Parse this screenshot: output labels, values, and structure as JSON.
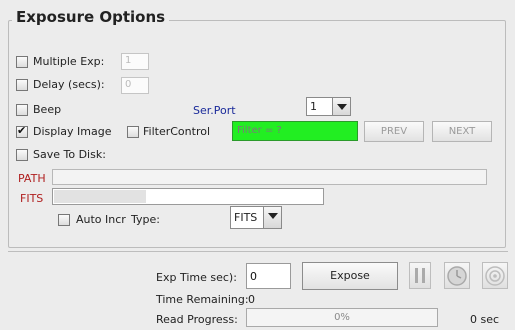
{
  "group": {
    "title": "Exposure Options"
  },
  "multiple_exp": {
    "label": "Multiple Exp:",
    "value": "1",
    "checked": false
  },
  "delay": {
    "label": "Delay (secs):",
    "value": "0",
    "checked": false
  },
  "beep": {
    "label": "Beep",
    "checked": false
  },
  "ser_port": {
    "label": "Ser.Port",
    "value": "1"
  },
  "display_image": {
    "label": "Display Image",
    "checked": true
  },
  "filter_control": {
    "label": "FilterControl",
    "checked": false,
    "status": "Filter = ?",
    "status_color": "#22ee22"
  },
  "prev_label": "PREV",
  "next_label": "NEXT",
  "save_to_disk": {
    "label": "Save To Disk:",
    "checked": false
  },
  "path": {
    "label": "PATH",
    "value": ""
  },
  "fits": {
    "label": "FITS",
    "value": ""
  },
  "auto_incr": {
    "label": "Auto Incr",
    "checked": false
  },
  "type": {
    "label": "Type:",
    "value": "FITS"
  },
  "exposure": {
    "time_label": "Exp Time sec):",
    "time_value": "0",
    "expose_label": "Expose",
    "remaining_label": "Time Remaining:",
    "remaining_value": "0",
    "progress_label": "Read Progress:",
    "progress_text": "0%",
    "progress": 0,
    "elapsed": "0 sec"
  },
  "icons": [
    "pause-icon",
    "clock-icon",
    "target-icon"
  ],
  "colors": {
    "accent_red": "#b02020",
    "accent_navy": "#1a2a9a"
  }
}
